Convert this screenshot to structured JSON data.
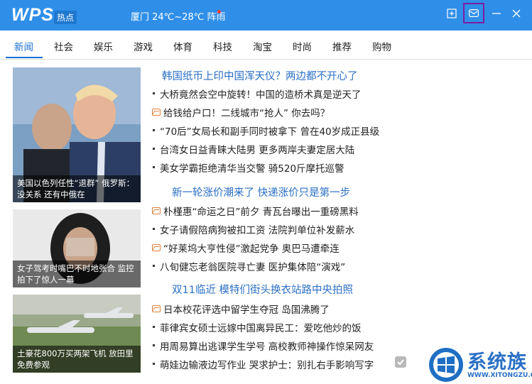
{
  "app": {
    "logo": "WPS",
    "badge": "热点",
    "weather": "厦门 24℃~28℃ 阵雨"
  },
  "window_controls": [
    "new-window-icon",
    "mail-icon",
    "minimize-icon",
    "close-icon"
  ],
  "tabs": [
    {
      "label": "新闻",
      "active": true
    },
    {
      "label": "社会"
    },
    {
      "label": "娱乐"
    },
    {
      "label": "游戏"
    },
    {
      "label": "体育"
    },
    {
      "label": "科技"
    },
    {
      "label": "淘宝"
    },
    {
      "label": "时尚"
    },
    {
      "label": "推荐"
    },
    {
      "label": "购物"
    }
  ],
  "thumbnails": [
    {
      "caption": "美国以色列任性“退群” 俄罗斯：没关系 还有中俄在"
    },
    {
      "caption": "女子驾考时嘴巴不时地张合 监控拍下了惊人一幕"
    },
    {
      "caption": "土豪花800万买两架飞机 放田里免费参观"
    }
  ],
  "sections": [
    {
      "headline": "韩国纸币上印中国浑天仪？两边都不开心了",
      "items": [
        {
          "text": "大桥竟然会空中旋转！中国的造桥术真是逆天了",
          "icon": "bullet"
        },
        {
          "text": "给钱给户口！二线城市“抢人” 你去吗？",
          "icon": "picture-icon"
        },
        {
          "text": "“70后”女局长和副手同时被拿下 曾在40岁成正县级",
          "icon": "bullet"
        },
        {
          "text": "台湾女日益青睐大陆男 更多两岸夫妻定居大陆",
          "icon": "bullet"
        },
        {
          "text": "美女学霸拒绝清华当交警 骑520斤摩托巡警",
          "icon": "bullet"
        }
      ]
    },
    {
      "headline": "新一轮涨价潮来了 快递涨价只是第一步",
      "items": [
        {
          "text": "朴槿惠“命运之日”前夕 青瓦台曝出一重磅黑料",
          "icon": "picture-icon"
        },
        {
          "text": "女子请假陪病狗被扣工资 法院判单位补发薪水",
          "icon": "bullet"
        },
        {
          "text": "“好莱坞大亨性侵”激起党争 奥巴马遭牵连",
          "icon": "picture-icon"
        },
        {
          "text": "八旬健忘老翁医院寻亡妻 医护集体陪“演戏”",
          "icon": "bullet"
        }
      ]
    },
    {
      "headline": "双11临近 模特们街头换衣站路中央拍照",
      "items": [
        {
          "text": "日本校花评选中留学生夺冠 岛国沸腾了",
          "icon": "picture-icon"
        },
        {
          "text": "菲律宾女硕士远嫁中国离异民工：爱吃他炒的饭",
          "icon": "bullet"
        },
        {
          "text": "用周易算出逃课学生学号 高校教师神操作惊呆网友",
          "icon": "bullet"
        },
        {
          "text": "萌娃边输液边写作业 哭求护士：别扎右手影响写字",
          "icon": "bullet"
        }
      ]
    }
  ],
  "watermark": {
    "text": "系统族",
    "url": "WWW.XITONGZU.COM"
  },
  "colors": {
    "titlebar": "#2f8fe8",
    "accent": "#1a6fd0",
    "headline": "#2a6fc5",
    "mail_highlight": "#7b1fa2"
  }
}
